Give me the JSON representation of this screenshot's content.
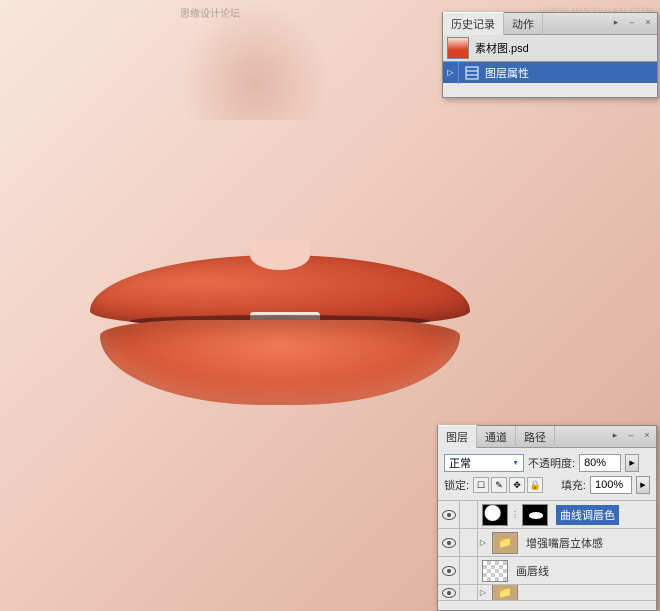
{
  "watermark_top": "思缘设计论坛",
  "watermark_site": "WWW.MISSYUAN.COM",
  "history_panel": {
    "tabs": {
      "history": "历史记录",
      "actions": "动作"
    },
    "document_name": "素材图.psd",
    "items": [
      {
        "label": "图层属性"
      }
    ]
  },
  "layers_panel": {
    "tabs": {
      "layers": "图层",
      "channels": "通道",
      "paths": "路径"
    },
    "blend_mode": "正常",
    "opacity_label": "不透明度:",
    "opacity_value": "80%",
    "lock_label": "锁定:",
    "fill_label": "填充:",
    "fill_value": "100%",
    "layers": [
      {
        "name": "曲线调唇色",
        "selected": true,
        "type": "adjustment"
      },
      {
        "name": "增强嘴唇立体感",
        "selected": false,
        "type": "group"
      },
      {
        "name": "画唇线",
        "selected": false,
        "type": "layer"
      },
      {
        "name": "",
        "selected": false,
        "type": "partial"
      }
    ]
  }
}
